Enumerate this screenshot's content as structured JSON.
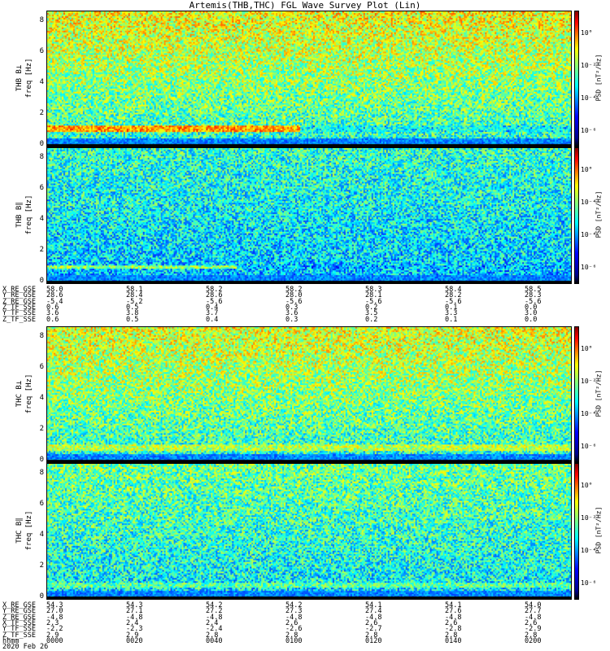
{
  "title": "Artemis(THB,THC) FGL Wave Survey Plot (Lin)",
  "chart_data": [
    {
      "type": "heatmap",
      "ylabel": "THB B_L\nfreq [Hz]",
      "ylabel_lines": [
        "THB B⊥",
        "freq [Hz]"
      ],
      "y_ticks": [
        "0",
        "2",
        "4",
        "6",
        "8"
      ],
      "ylim": [
        0,
        8.5
      ],
      "colorbar_label": "PSD [nT²/Hz]",
      "colorbar_ticks": [
        "10°",
        "10⁻²",
        "10⁻⁴",
        "10⁻⁶"
      ],
      "band_low": "1.0-1.5 Hz enhanced before 01:00"
    },
    {
      "type": "heatmap",
      "ylabel_lines": [
        "THB B∥",
        "freq [Hz]"
      ],
      "y_ticks": [
        "0",
        "2",
        "4",
        "6",
        "8"
      ],
      "ylim": [
        0,
        8.5
      ],
      "colorbar_label": "PSD [nT²/Hz]",
      "colorbar_ticks": [
        "10°",
        "10⁻⁴",
        "10⁻⁴",
        "10⁻⁶"
      ]
    },
    {
      "type": "heatmap",
      "ylabel_lines": [
        "THC B⊥",
        "freq [Hz]"
      ],
      "y_ticks": [
        "0",
        "2",
        "4",
        "6",
        "8"
      ],
      "ylim": [
        0,
        8.5
      ],
      "colorbar_label": "PSD [nT²/Hz]",
      "colorbar_ticks": [
        "10°",
        "10⁻²",
        "10⁻⁴",
        "10⁻⁶"
      ]
    },
    {
      "type": "heatmap",
      "ylabel_lines": [
        "THC B∥",
        "freq [Hz]"
      ],
      "y_ticks": [
        "0",
        "2",
        "4",
        "6",
        "8"
      ],
      "ylim": [
        0,
        8.5
      ],
      "colorbar_label": "PSD [nT²/Hz]",
      "colorbar_ticks": [
        "10°",
        "10⁻²",
        "10⁻⁴",
        "10⁻⁶"
      ]
    }
  ],
  "eph_top": {
    "labels": [
      "X_RE_GSE",
      "Y_RE_GSE",
      "Z_RE_GSE",
      "Z_TF_SSE",
      "Y_TF_SSE",
      "Z_TF_SSE"
    ],
    "columns": [
      [
        "58.0",
        "28.6",
        "-5.4",
        "0.6",
        "3.6",
        "0.6"
      ],
      [
        "58.1",
        "28.4",
        "-5.2",
        "0.5",
        "3.8",
        "0.5"
      ],
      [
        "58.2",
        "28.6",
        "-5.6",
        "0.4",
        "3.7",
        "0.4"
      ],
      [
        "58.2",
        "28.0",
        "-5.6",
        "0.3",
        "3.6",
        "0.3"
      ],
      [
        "58.3",
        "28.1",
        "-5.6",
        "0.2",
        "3.5",
        "0.2"
      ],
      [
        "58.4",
        "28.2",
        "-5.6",
        "0.1",
        "3.3",
        "0.1"
      ],
      [
        "58.5",
        "28.3",
        "-5.6",
        "0.0",
        "3.0",
        "0.0"
      ]
    ]
  },
  "eph_bottom": {
    "labels": [
      "X_RE_GSE",
      "Y_RE_GSE",
      "Z_RE_GSE",
      "X_TF_SSE",
      "Y_TF_SSE",
      "Z_TF_SSE",
      "hhmm",
      "2020 Feb 26"
    ],
    "columns": [
      [
        "54.3",
        "27.0",
        "-4.8",
        "2.3",
        "-2.2",
        "2.9",
        "0000"
      ],
      [
        "54.3",
        "27.1",
        "-4.8",
        "2.4",
        "-2.3",
        "2.9",
        "0020"
      ],
      [
        "54.2",
        "27.2",
        "-4.8",
        "2.4",
        "-2.4",
        "2.8",
        "0040"
      ],
      [
        "54.2",
        "27.3",
        "-4.8",
        "2.6",
        "-2.6",
        "2.8",
        "0100"
      ],
      [
        "54.1",
        "27.4",
        "-4.8",
        "2.6",
        "-2.7",
        "2.8",
        "0120"
      ],
      [
        "54.1",
        "27.6",
        "-4.8",
        "2.6",
        "-2.8",
        "2.8",
        "0140"
      ],
      [
        "54.0",
        "27.7",
        "-4.8",
        "2.6",
        "-2.9",
        "2.8",
        "0200"
      ]
    ]
  }
}
